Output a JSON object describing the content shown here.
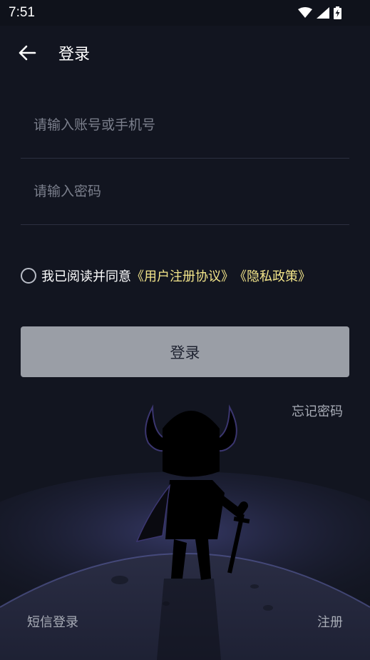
{
  "status_bar": {
    "time": "7:51",
    "icons": [
      "wifi-icon",
      "cellular-signal-icon",
      "battery-charging-icon"
    ]
  },
  "header": {
    "back_icon": "arrow-left-icon",
    "title": "登录"
  },
  "form": {
    "account_placeholder": "请输入账号或手机号",
    "account_value": "",
    "password_placeholder": "请输入密码",
    "password_value": ""
  },
  "agreement": {
    "checked": false,
    "prefix": "我已阅读并同意",
    "user_agreement": "《用户注册协议》",
    "privacy_policy": "《隐私政策》"
  },
  "actions": {
    "login_label": "登录",
    "forgot_password": "忘记密码",
    "sms_login": "短信登录",
    "register": "注册"
  },
  "colors": {
    "background": "#121520",
    "link_accent": "#f3e58a",
    "button_disabled": "#9a9ea6"
  }
}
